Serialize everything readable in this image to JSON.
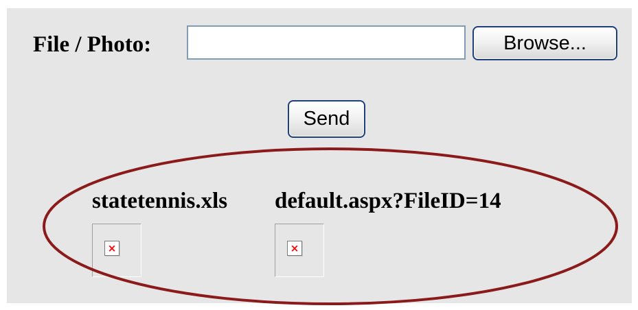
{
  "form": {
    "file_label": "File / Photo:",
    "file_input_value": "",
    "browse_label": "Browse...",
    "send_label": "Send"
  },
  "attachments": [
    {
      "name": "statetennis.xls",
      "icon": "broken-image-icon"
    },
    {
      "name": "default.aspx?FileID=14",
      "icon": "broken-image-icon"
    }
  ],
  "broken_image_glyph": "×",
  "colors": {
    "panel_background": "#e6e6e6",
    "highlight_ellipse": "#8b1a1a",
    "broken_image_x": "#ff0000",
    "button_border": "#1e3f7a",
    "input_border": "#7f9db9"
  }
}
